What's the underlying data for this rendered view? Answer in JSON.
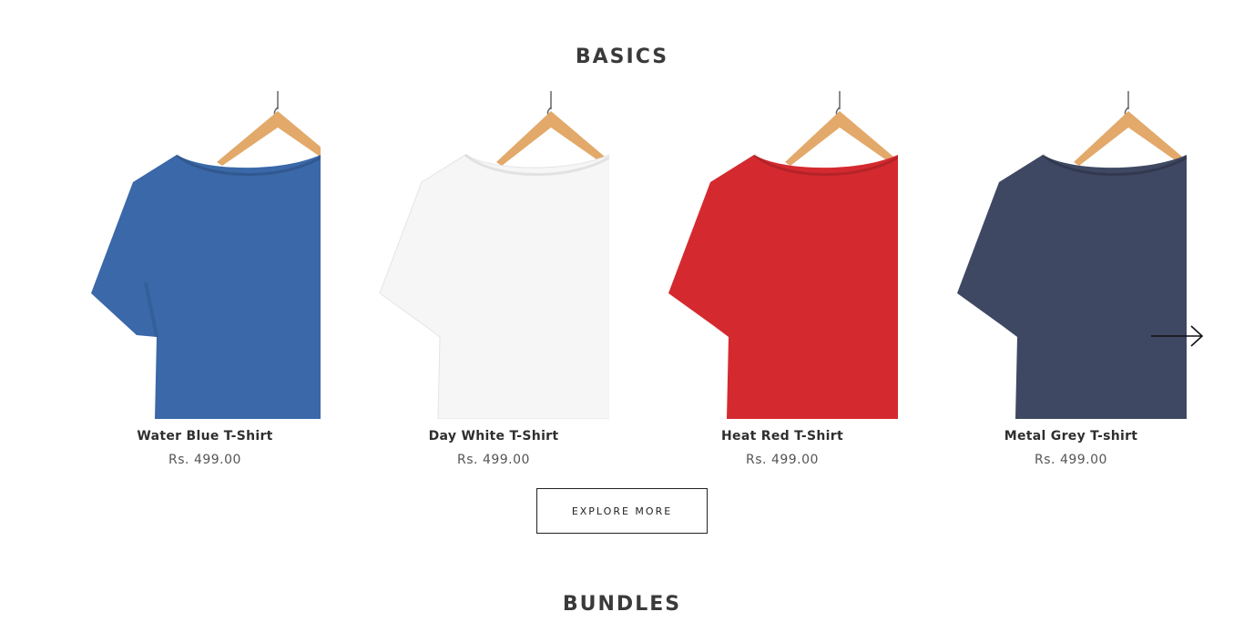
{
  "sections": {
    "basics_title": "BASICS",
    "bundles_title": "BUNDLES"
  },
  "products": [
    {
      "name": "Water Blue T-Shirt",
      "price": "Rs. 499.00",
      "color": "#3a68a8"
    },
    {
      "name": "Day White T-Shirt",
      "price": "Rs. 499.00",
      "color": "#f6f6f6"
    },
    {
      "name": "Heat Red T-Shirt",
      "price": "Rs. 499.00",
      "color": "#d42a2f"
    },
    {
      "name": "Metal Grey T-shirt",
      "price": "Rs. 499.00",
      "color": "#3f4863"
    }
  ],
  "carousel": {
    "next_icon": "arrow-right-icon"
  },
  "cta": {
    "explore_label": "EXPLORE MORE"
  },
  "colors": {
    "hanger": "#e2a96a",
    "button_border": "#222222"
  }
}
